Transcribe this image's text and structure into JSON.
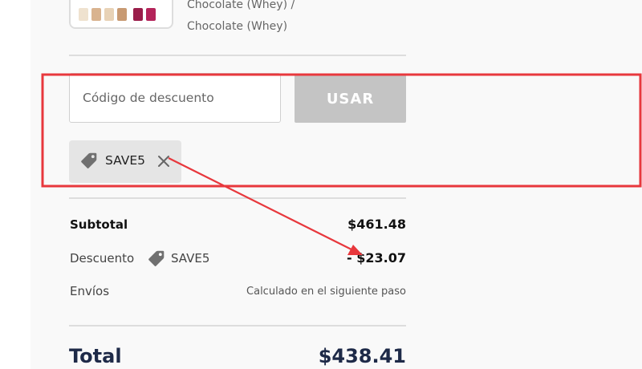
{
  "product": {
    "variant_line1": "Chocolate (Whey) /",
    "variant_line2": "Chocolate (Whey)"
  },
  "discount_form": {
    "placeholder": "Código de descuento",
    "apply_label": "USAR",
    "applied_code": "SAVE5"
  },
  "summary": {
    "subtotal_label": "Subtotal",
    "subtotal_value": "$461.48",
    "discount_label": "Descuento",
    "discount_code": "SAVE5",
    "discount_value": "- $23.07",
    "shipping_label": "Envíos",
    "shipping_value": "Calculado en el siguiente paso",
    "total_label": "Total",
    "total_value": "$438.41"
  },
  "annotation": {
    "highlight_color": "#e8383d",
    "icons": [
      "tag-icon",
      "close-icon",
      "arrow-icon"
    ]
  }
}
